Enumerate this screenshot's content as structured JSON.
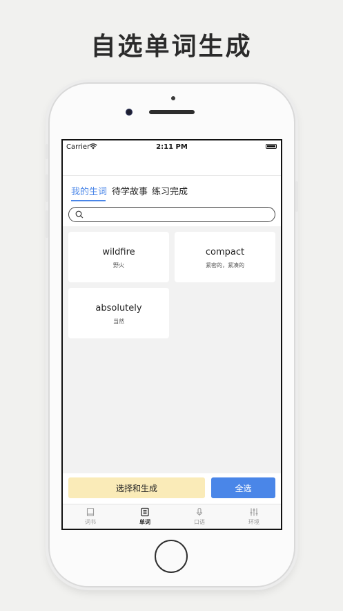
{
  "headline": "自选单词生成",
  "status_bar": {
    "carrier": "Carrier",
    "time": "2:11 PM"
  },
  "tabs": [
    {
      "label": "我的生词",
      "active": true
    },
    {
      "label": "待学故事",
      "active": false
    },
    {
      "label": "练习完成",
      "active": false
    }
  ],
  "search": {
    "placeholder": ""
  },
  "words": [
    {
      "word": "wildfire",
      "meaning": "野火"
    },
    {
      "word": "compact",
      "meaning": "紧密的，紧凑的"
    },
    {
      "word": "absolutely",
      "meaning": "当然"
    }
  ],
  "actions": {
    "generate_label": "选择和生成",
    "select_all_label": "全选"
  },
  "tabbar": [
    {
      "label": "词书",
      "icon": "book-icon",
      "active": false
    },
    {
      "label": "单词",
      "icon": "newspaper-icon",
      "active": true
    },
    {
      "label": "口语",
      "icon": "microphone-icon",
      "active": false
    },
    {
      "label": "环境",
      "icon": "sliders-icon",
      "active": false
    }
  ],
  "colors": {
    "accent": "#4a86e8",
    "generate_button": "#faebb8"
  }
}
